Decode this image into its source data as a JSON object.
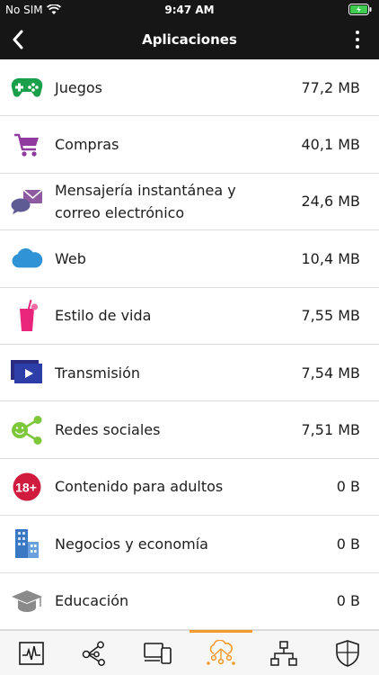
{
  "status_bar": {
    "carrier": "No SIM",
    "time": "9:47 AM"
  },
  "header": {
    "title": "Aplicaciones"
  },
  "categories": [
    {
      "label": "Juegos",
      "size": "77,2 MB",
      "icon": "gamepad-icon",
      "color": "#1aa04a"
    },
    {
      "label": "Compras",
      "size": "40,1 MB",
      "icon": "shopping-cart-icon",
      "color": "#8e3a9e"
    },
    {
      "label": "Mensajería instantánea y correo electrónico",
      "size": "24,6 MB",
      "icon": "messaging-icon",
      "color": "#6a5a94"
    },
    {
      "label": "Web",
      "size": "10,4 MB",
      "icon": "cloud-icon",
      "color": "#2f93d6"
    },
    {
      "label": "Estilo de vida",
      "size": "7,55 MB",
      "icon": "drink-icon",
      "color": "#e8257a"
    },
    {
      "label": "Transmisión",
      "size": "7,54 MB",
      "icon": "video-icon",
      "color": "#2a2a80"
    },
    {
      "label": "Redes sociales",
      "size": "7,51 MB",
      "icon": "social-icon",
      "color": "#7cc73a"
    },
    {
      "label": "Contenido para adultos",
      "size": "0 B",
      "icon": "adult-18-icon",
      "color": "#d01b3e"
    },
    {
      "label": "Negocios y economía",
      "size": "0 B",
      "icon": "buildings-icon",
      "color": "#3b78c4"
    },
    {
      "label": "Educación",
      "size": "0 B",
      "icon": "graduation-cap-icon",
      "color": "#8a8a8a"
    }
  ],
  "tabs": [
    {
      "name": "tab-activity",
      "icon": "activity-icon"
    },
    {
      "name": "tab-network",
      "icon": "network-nodes-icon"
    },
    {
      "name": "tab-devices",
      "icon": "devices-icon"
    },
    {
      "name": "tab-apps",
      "icon": "apps-cloud-icon",
      "active": true
    },
    {
      "name": "tab-topology",
      "icon": "topology-icon"
    },
    {
      "name": "tab-security",
      "icon": "shield-icon"
    }
  ],
  "colors": {
    "accent": "#f39a2a",
    "header_bg": "#161616"
  }
}
